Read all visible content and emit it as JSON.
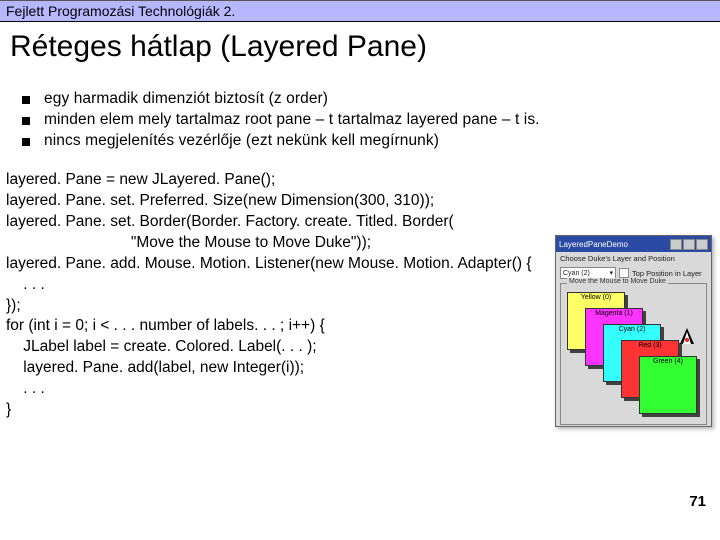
{
  "header": {
    "text": "Fejlett Programozási Technológiák 2."
  },
  "title": "Réteges hátlap (Layered Pane)",
  "bullets": [
    "egy harmadik dimenziót biztosít (z order)",
    "minden elem mely tartalmaz root pane – t tartalmaz layered pane – t is.",
    "nincs megjelenítés vezérlője (ezt nekünk kell megírnunk)"
  ],
  "code_lines": [
    "layered. Pane = new JLayered. Pane();",
    "layered. Pane. set. Preferred. Size(new Dimension(300, 310));",
    "layered. Pane. set. Border(Border. Factory. create. Titled. Border(",
    "                             \"Move the Mouse to Move Duke\"));",
    "layered. Pane. add. Mouse. Motion. Listener(new Mouse. Motion. Adapter() {",
    "    . . .",
    "});",
    "for (int i = 0; i < . . . number of labels. . . ; i++) {",
    "    JLabel label = create. Colored. Label(. . . );",
    "    layered. Pane. add(label, new Integer(i));",
    "    . . .",
    "}"
  ],
  "page_number": "71",
  "demo": {
    "window_title": "LayeredPaneDemo",
    "row1_label": "Choose Duke's Layer and Position",
    "select_value": "Cyan (2)",
    "checkbox_label": "Top Position in Layer",
    "stage_title": "Move the Mouse to Move Duke",
    "layers": [
      {
        "label": "Yellow (0)"
      },
      {
        "label": "Magenta (1)"
      },
      {
        "label": "Cyan (2)"
      },
      {
        "label": "Red (3)"
      },
      {
        "label": "Green (4)"
      }
    ]
  }
}
